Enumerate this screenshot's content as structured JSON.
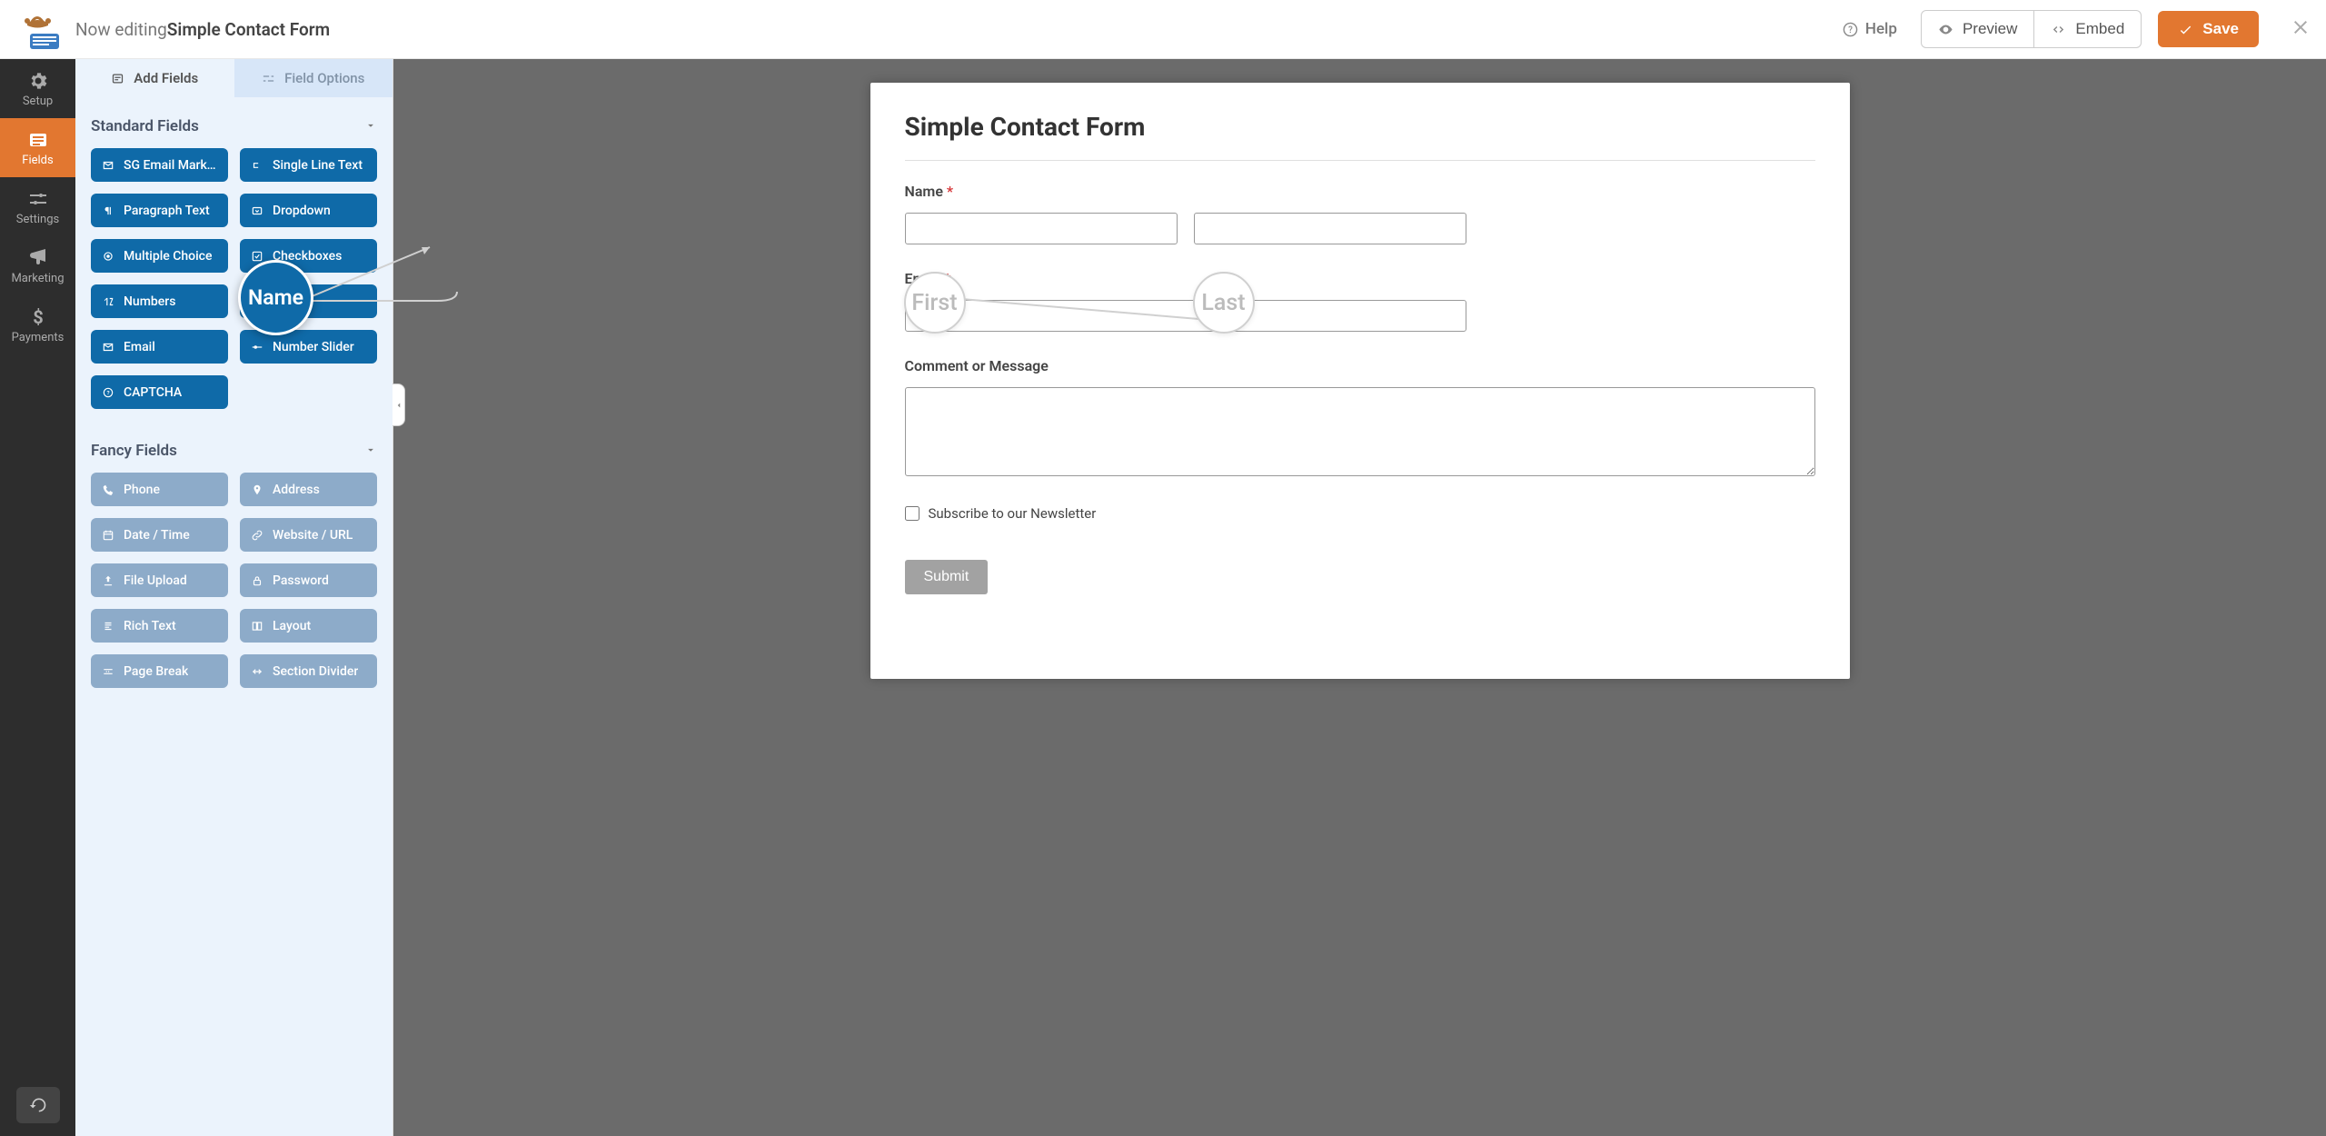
{
  "header": {
    "editing_prefix": "Now editing ",
    "form_name": "Simple Contact Form",
    "help": "Help",
    "preview": "Preview",
    "embed": "Embed",
    "save": "Save"
  },
  "sidenav": {
    "setup": "Setup",
    "fields": "Fields",
    "settings": "Settings",
    "marketing": "Marketing",
    "payments": "Payments"
  },
  "panel_tabs": {
    "add_fields": "Add Fields",
    "field_options": "Field Options"
  },
  "groups": {
    "standard": "Standard Fields",
    "fancy": "Fancy Fields"
  },
  "standard_fields": [
    {
      "label": "SG Email Market..."
    },
    {
      "label": "Single Line Text"
    },
    {
      "label": "Paragraph Text"
    },
    {
      "label": "Dropdown"
    },
    {
      "label": "Multiple Choice"
    },
    {
      "label": "Checkboxes"
    },
    {
      "label": "Numbers"
    },
    {
      "label": "Name"
    },
    {
      "label": "Email"
    },
    {
      "label": "Number Slider"
    },
    {
      "label": "CAPTCHA"
    }
  ],
  "fancy_fields": [
    {
      "label": "Phone"
    },
    {
      "label": "Address"
    },
    {
      "label": "Date / Time"
    },
    {
      "label": "Website / URL"
    },
    {
      "label": "File Upload"
    },
    {
      "label": "Password"
    },
    {
      "label": "Rich Text"
    },
    {
      "label": "Layout"
    },
    {
      "label": "Page Break"
    },
    {
      "label": "Section Divider"
    }
  ],
  "drag_field": "Name",
  "form": {
    "title": "Simple Contact Form",
    "name_label": "Name",
    "email_label": "Email",
    "comment_label": "Comment or Message",
    "newsletter_label": "Subscribe to our Newsletter",
    "submit": "Submit",
    "ghost_first": "First",
    "ghost_last": "Last"
  }
}
